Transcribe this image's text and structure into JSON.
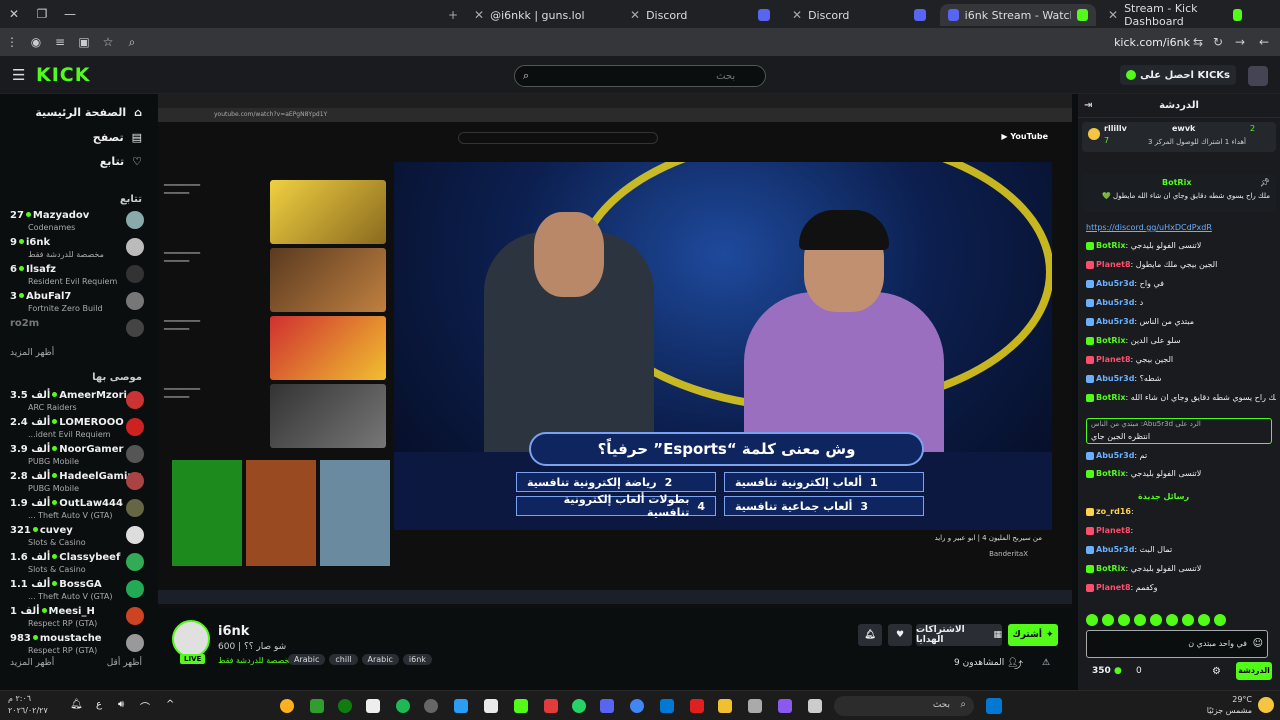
{
  "browser": {
    "tabs": [
      {
        "label": "@i6nkk | guns.lol"
      },
      {
        "label": "Discord"
      },
      {
        "label": "Discord"
      },
      {
        "label": "i6nk Stream - Watch Live on Ki"
      },
      {
        "label": "Stream - Kick Dashboard"
      }
    ],
    "url": "kick.com/i6nk"
  },
  "kick": {
    "logo": "KICK",
    "search_placeholder": "بحث",
    "get_kicks": "احصل على KICKs"
  },
  "sidebar": {
    "nav": [
      {
        "label": "الصفحة الرئيسية"
      },
      {
        "label": "تصفح"
      },
      {
        "label": "تتابع"
      }
    ],
    "following_header": "تتابع",
    "following": [
      {
        "viewers": "27",
        "name": "Mazyadov",
        "sub": "Codenames"
      },
      {
        "viewers": "9",
        "name": "i6nk",
        "sub": "مخصصة للدردشة فقط"
      },
      {
        "viewers": "6",
        "name": "Ilsafz",
        "sub": "Resident Evil Requiem"
      },
      {
        "viewers": "3",
        "name": "AbuFal7",
        "sub": "Fortnite Zero Build"
      },
      {
        "viewers": "",
        "name": "ro2m",
        "sub": ""
      }
    ],
    "show_more": "أظهر المزيد",
    "recommended_header": "موصى بها",
    "recommended": [
      {
        "viewers": "3.5 ألف",
        "name": "AmeerMzori",
        "sub": "ARC Raiders"
      },
      {
        "viewers": "2.4 ألف",
        "name": "LOMEROOO",
        "sub": "...ident Evil Requiem"
      },
      {
        "viewers": "3.9 ألف",
        "name": "NoorGamer",
        "sub": "PUBG Mobile"
      },
      {
        "viewers": "2.8 ألف",
        "name": "HadeelGaming",
        "sub": "PUBG Mobile"
      },
      {
        "viewers": "1.9 ألف",
        "name": "OutLaw444",
        "sub": "... Theft Auto V (GTA)"
      },
      {
        "viewers": "321",
        "name": "cuvey",
        "sub": "Slots & Casino"
      },
      {
        "viewers": "1.6 ألف",
        "name": "Classybeef",
        "sub": "Slots & Casino"
      },
      {
        "viewers": "1.1 ألف",
        "name": "BossGA",
        "sub": "... Theft Auto V (GTA)"
      },
      {
        "viewers": "1 ألف",
        "name": "Meesi_H",
        "sub": "Respect RP (GTA)"
      },
      {
        "viewers": "983",
        "name": "moustache",
        "sub": "Respect RP (GTA)"
      }
    ],
    "show_more2": "أظهر المزيد",
    "show_less": "أظهر أقل"
  },
  "video": {
    "yt_url": "youtube.com/watch?v=aEPgN8Ypd1Y",
    "question": "وش معنى كلمة “Esports” حرفياً؟",
    "answers": [
      {
        "n": "1",
        "text": "ألعاب إلكترونية تنافسية"
      },
      {
        "n": "2",
        "text": "رياضة إلكترونية تنافسية"
      },
      {
        "n": "3",
        "text": "ألعاب جماعية تنافسية"
      },
      {
        "n": "4",
        "text": "بطولات ألعاب إلكترونية تنافسية"
      }
    ],
    "yt_title": "من سيربح المليون 4 | ابو عبير و رايد",
    "yt_channel": "BanderitaX"
  },
  "stream": {
    "name": "i6nk",
    "live": "LIVE",
    "title": "شو صار ؟؟ | 600",
    "category": "مخصصة للدردشة فقط",
    "tags": [
      "Arabic",
      "chill",
      "Arabic",
      "i6nk"
    ],
    "follow": "أشترك",
    "gift": "الاشتراكات الهدايا",
    "viewers": "المشاهدون 9"
  },
  "chat": {
    "title": "الدردشة",
    "top_user": "rllillv",
    "top_user2": "ewvk",
    "top_count": "7",
    "top_count2": "2",
    "top_note": "أهداء 1 اشتراك للوصول المركز 3",
    "pinned_user": "BotRix",
    "pinned_text": "ملك راح يسوي شطه دقايق وجاي ان شاء الله مايطول 💚",
    "link": "https://discord.gg/uHxDCdPxdR",
    "messages": [
      {
        "u": "BotRix",
        "t": "لاتنسى الفولو بليدجي",
        "c": "#53fc18"
      },
      {
        "u": "Planet8",
        "t": "الجين بيجي ملك مايطول",
        "c": "#ff4d6d"
      },
      {
        "u": "Abu5r3d",
        "t": "في واح",
        "c": "#6ab0ff"
      },
      {
        "u": "Abu5r3d",
        "t": "د",
        "c": "#6ab0ff"
      },
      {
        "u": "Abu5r3d",
        "t": "مبتدي من الناس",
        "c": "#6ab0ff"
      },
      {
        "u": "BotRix",
        "t": "سلو على الدين",
        "c": "#53fc18"
      },
      {
        "u": "Planet8",
        "t": "الجين بيجي",
        "c": "#ff4d6d"
      },
      {
        "u": "Abu5r3d",
        "t": "شطه؟",
        "c": "#6ab0ff"
      },
      {
        "u": "BotRix",
        "t": "ملك راح يسوي شطه دقايق وجاي ان شاء الله",
        "c": "#53fc18"
      }
    ],
    "reply_context": "الرد على Abu5r3d: مبتدي من الناس",
    "reply_text": "انتظره الجين جاي",
    "after": [
      {
        "u": "Abu5r3d",
        "t": "تم",
        "c": "#6ab0ff"
      },
      {
        "u": "BotRix",
        "t": "لاتنسى الفولو بليدجي",
        "c": "#53fc18"
      }
    ],
    "new_messages": "رسائل جديدة",
    "after2": [
      {
        "u": "zo_rd16",
        "t": "",
        "c": "#ffd24d"
      },
      {
        "u": "Planet8",
        "t": "",
        "c": "#ff4d6d"
      },
      {
        "u": "Abu5r3d",
        "t": "تمال البث",
        "c": "#6ab0ff"
      },
      {
        "u": "BotRix",
        "t": "لاتنسى الفولو بليدجي",
        "c": "#53fc18"
      },
      {
        "u": "Planet8",
        "t": "وكفمم",
        "c": "#ff4d6d"
      }
    ],
    "input_text": "في واحد مبتدي ن",
    "kicks_count": "350",
    "zero": "0",
    "send": "الدردشة"
  },
  "taskbar": {
    "search": "بحث",
    "time": "٢:٠٦ م",
    "date": "٢٠٢٦/٠٢/٢٧",
    "temp": "29°C",
    "weather": "مشمس جزئيًا"
  },
  "colors": {
    "accent": "#53fc18",
    "bg": "#0b0e0f",
    "panel": "#191b1f"
  }
}
